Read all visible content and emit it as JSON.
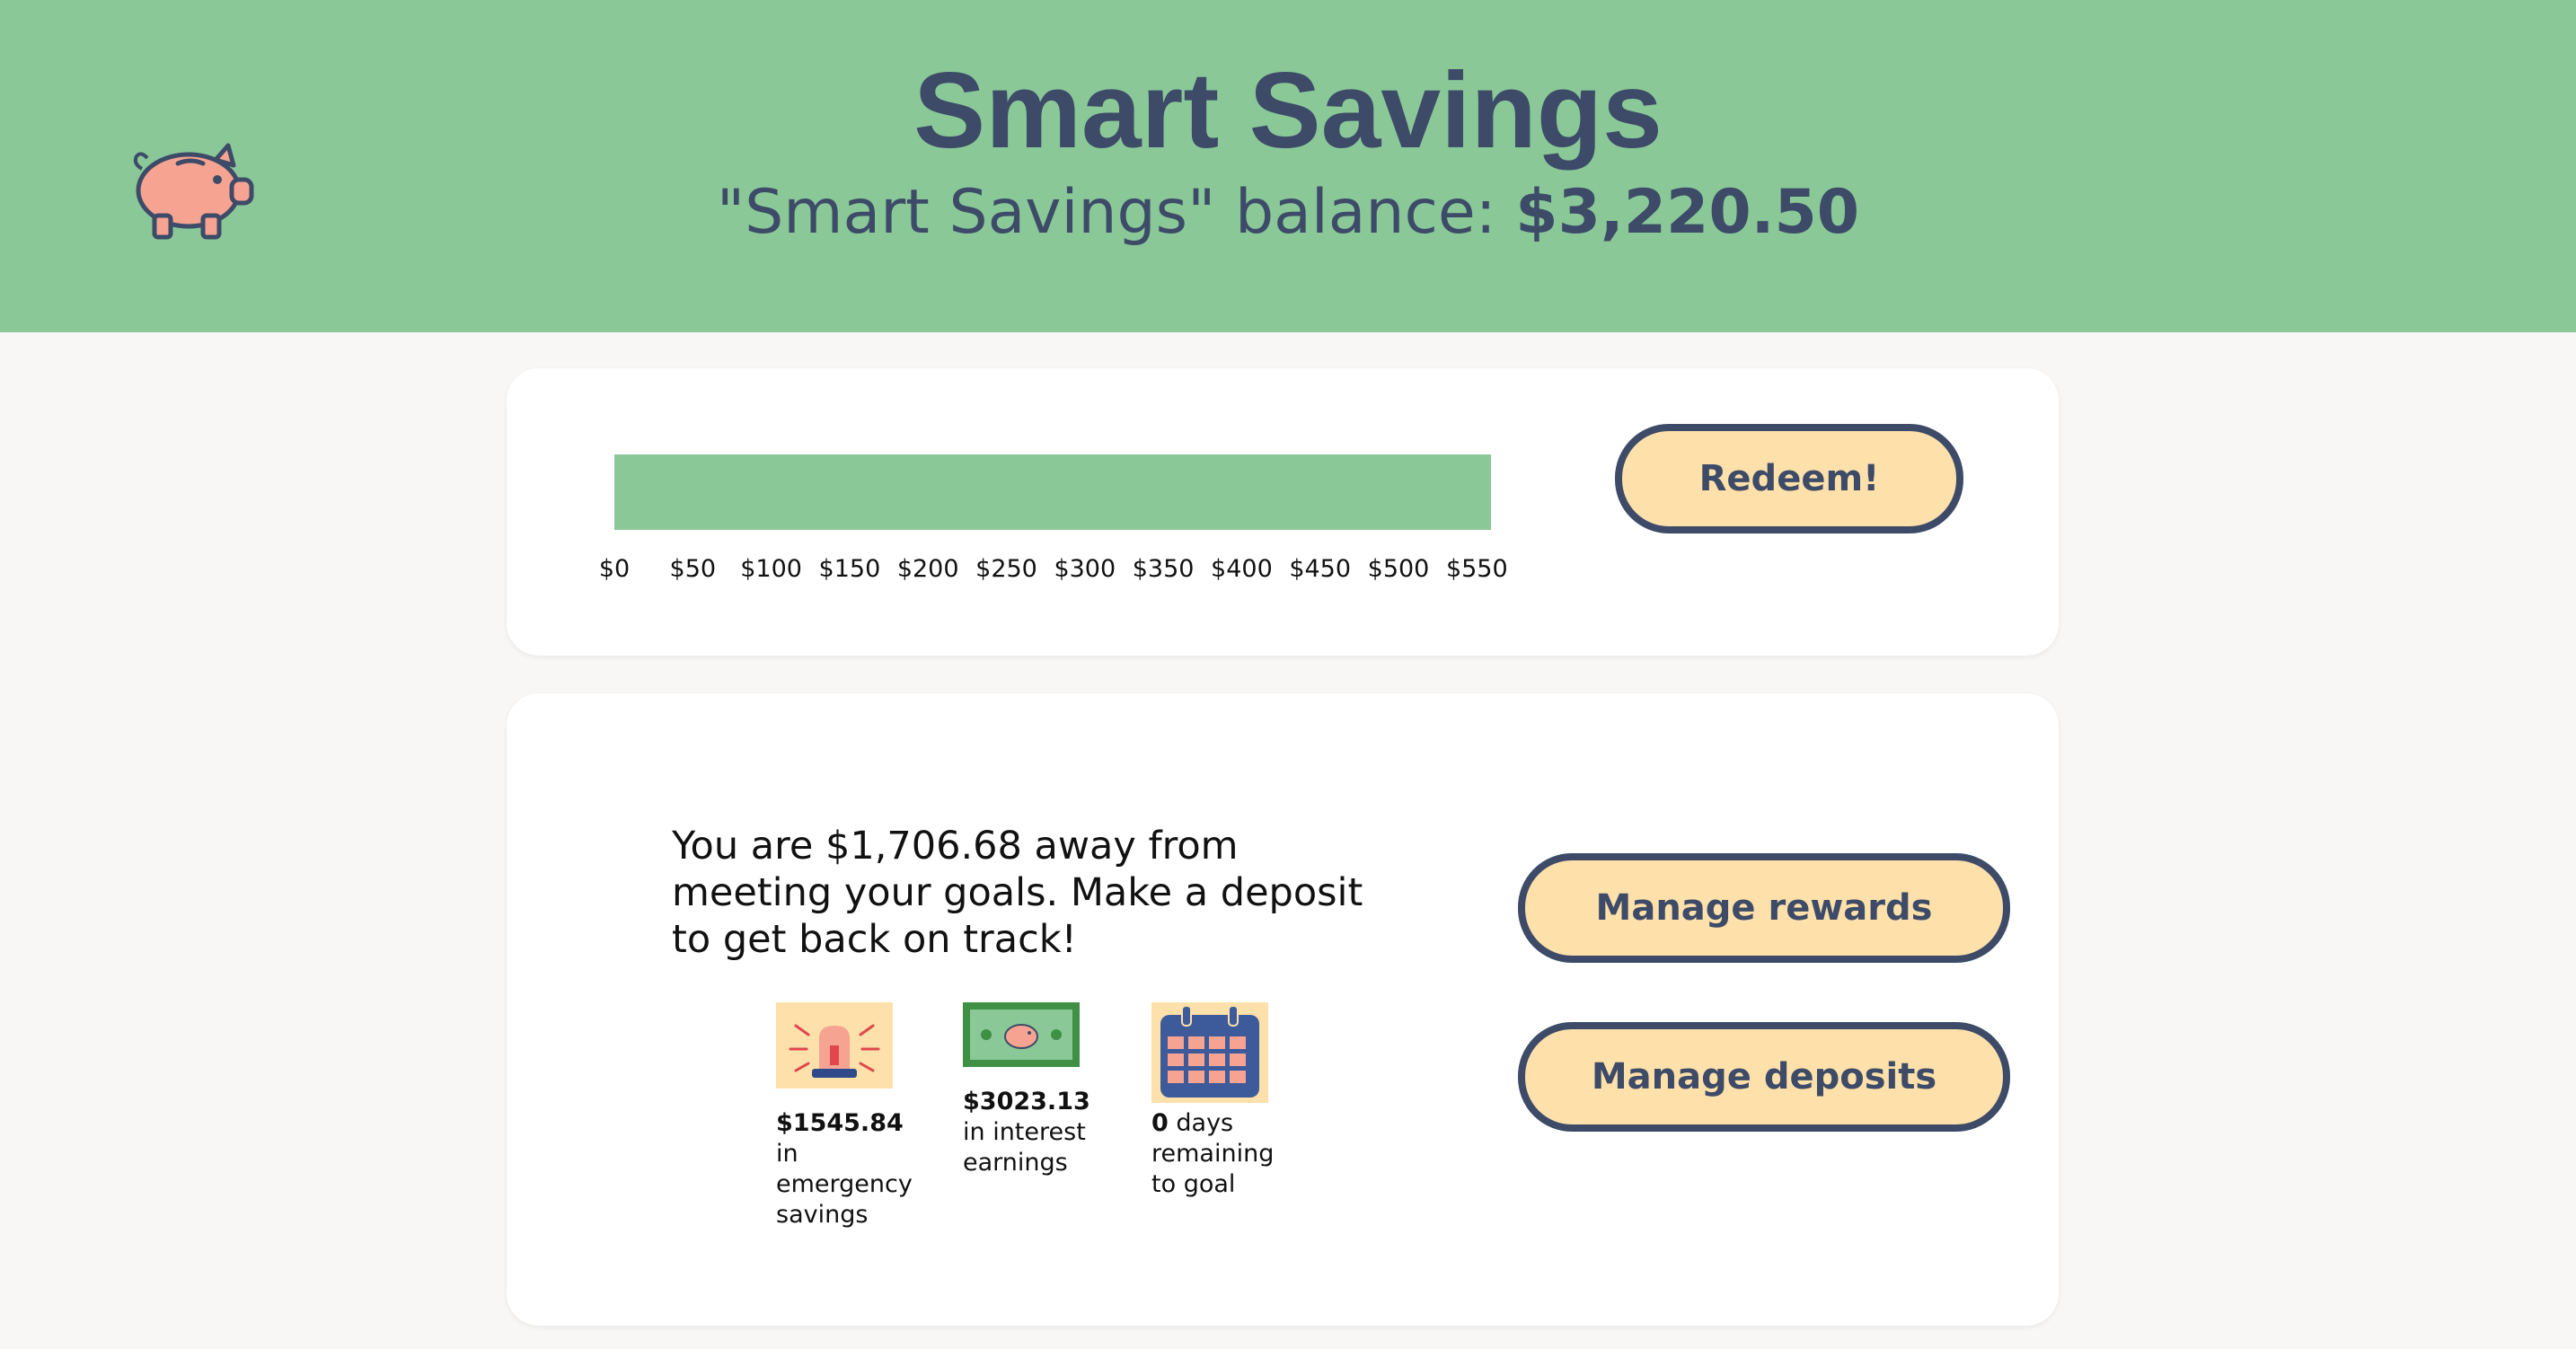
{
  "header": {
    "title": "Smart Savings",
    "balance_label": "\"Smart Savings\" balance:",
    "balance_amount": "$3,220.50"
  },
  "progress": {
    "ticks": [
      "$0",
      "$50",
      "$100",
      "$150",
      "$200",
      "$250",
      "$300",
      "$350",
      "$400",
      "$450",
      "$500",
      "$550"
    ],
    "axis_max": 550,
    "value": 560,
    "redeem_label": "Redeem!"
  },
  "goals": {
    "message": "You are $1,706.68 away from meeting your goals. Make a deposit to get back on track!",
    "stats": [
      {
        "icon": "alarm-siren-icon",
        "value": "$1545.84",
        "label": "in emergency savings"
      },
      {
        "icon": "money-bill-icon",
        "value": "$3023.13",
        "label": "in interest earnings"
      },
      {
        "icon": "calendar-icon",
        "value": "0",
        "label": "days remaining to goal"
      }
    ],
    "manage_rewards_label": "Manage rewards",
    "manage_deposits_label": "Manage deposits"
  },
  "colors": {
    "brand_green": "#8ac898",
    "navy": "#3d4b68",
    "button_fill": "#fde0aa",
    "piggy_pink": "#f7a392"
  }
}
